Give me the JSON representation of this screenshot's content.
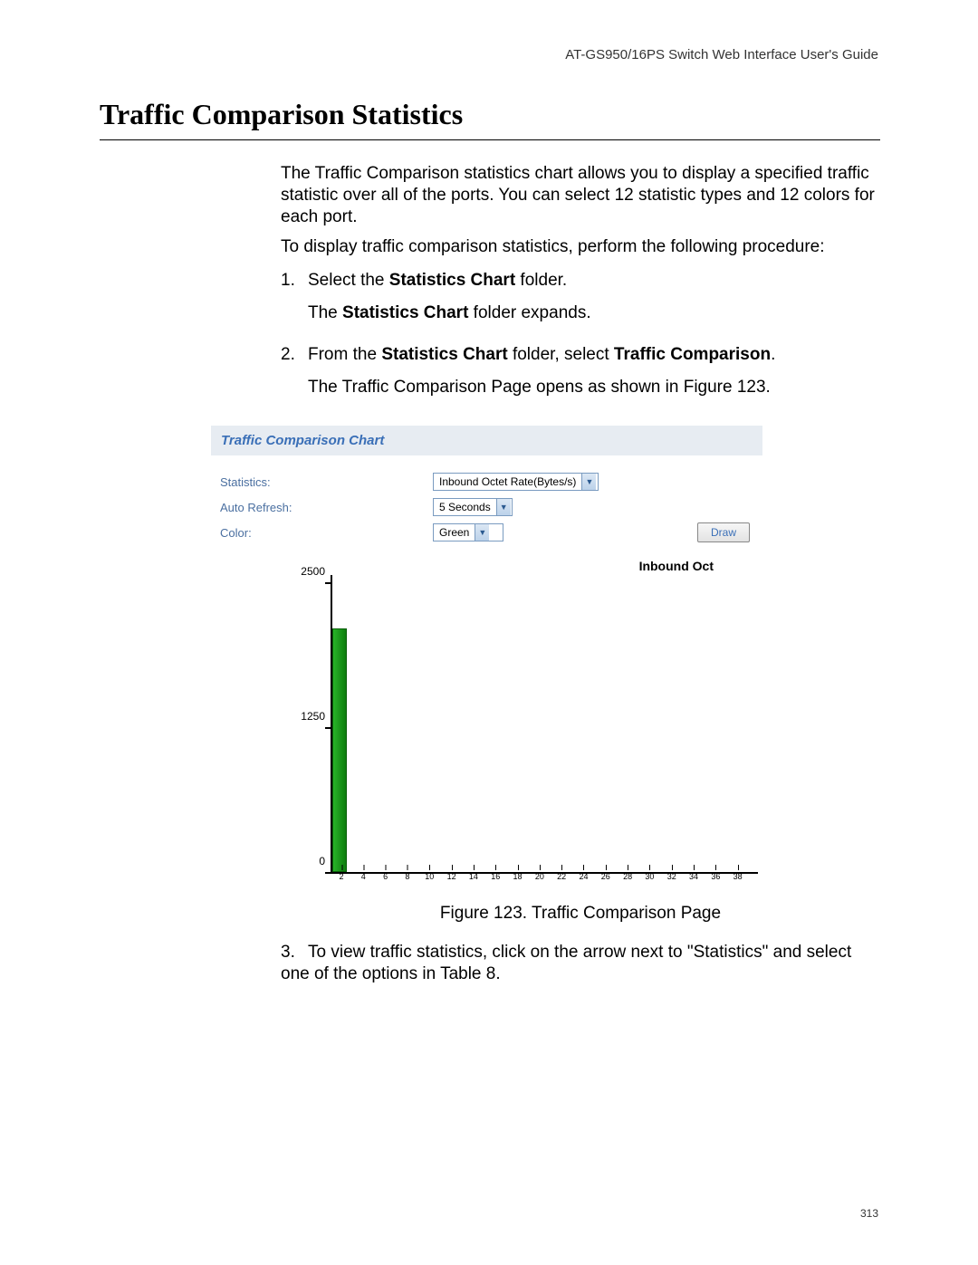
{
  "running_head": "AT-GS950/16PS Switch Web Interface User's Guide",
  "title": "Traffic Comparison Statistics",
  "para1": "The Traffic Comparison statistics chart allows you to display a specified traffic statistic over all of the ports. You can select 12 statistic types and 12 colors for each port.",
  "para2": "To display traffic comparison statistics, perform the following procedure:",
  "step1_num": "1.",
  "step1_a": "Select the ",
  "step1_bold": "Statistics Chart",
  "step1_b": " folder.",
  "step1c_a": "The ",
  "step1c_bold": "Statistics Chart",
  "step1c_b": " folder expands.",
  "step2_num": "2.",
  "step2_a": "From the ",
  "step2_bold1": "Statistics Chart",
  "step2_b": " folder, select ",
  "step2_bold2": "Traffic Comparison",
  "step2_c": ".",
  "step2d": "The Traffic Comparison Page opens as shown in Figure 123.",
  "panel_title": "Traffic Comparison Chart",
  "form": {
    "statistics_label": "Statistics:",
    "statistics_value": "Inbound Octet Rate(Bytes/s)",
    "autorefresh_label": "Auto Refresh:",
    "autorefresh_value": "5 Seconds",
    "color_label": "Color:",
    "color_value": "Green",
    "draw_label": "Draw"
  },
  "chart_data": {
    "type": "bar",
    "title": "Inbound Oct",
    "ylabel": "",
    "xlabel": "",
    "ylim": [
      0,
      2500
    ],
    "y_ticks": [
      0,
      1250,
      2500
    ],
    "categories": [
      "2",
      "4",
      "6",
      "8",
      "10",
      "12",
      "14",
      "16",
      "18",
      "20",
      "22",
      "24",
      "26",
      "28",
      "30",
      "32",
      "34",
      "36",
      "38"
    ],
    "values": [
      2100,
      0,
      0,
      0,
      0,
      0,
      0,
      0,
      0,
      0,
      0,
      0,
      0,
      0,
      0,
      0,
      0,
      0,
      0
    ],
    "bar_color": "#28b428"
  },
  "figure_caption": "Figure 123. Traffic Comparison Page",
  "step3_num": "3.",
  "step3": "To view traffic statistics, click on the arrow next to \"Statistics\" and select one of the options in Table 8.",
  "page_number": "313"
}
